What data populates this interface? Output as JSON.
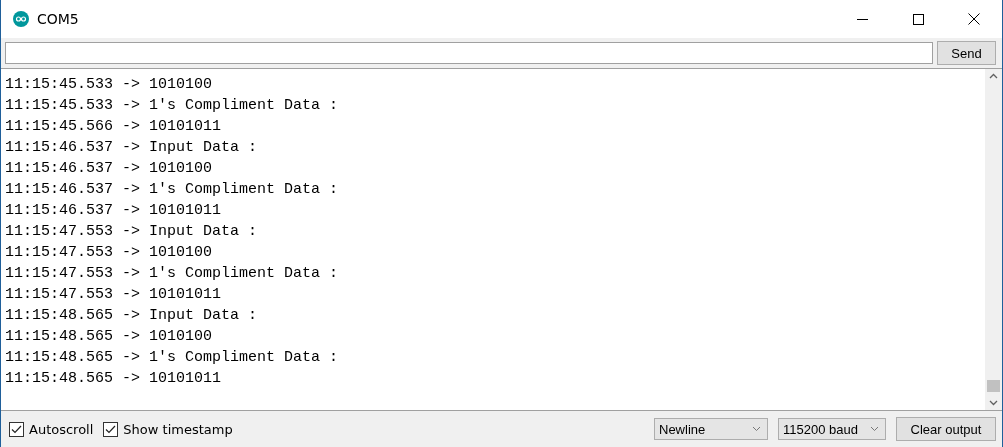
{
  "window": {
    "title": "COM5"
  },
  "send_button": "Send",
  "output_lines": [
    "11:15:45.533 -> 1010100",
    "11:15:45.533 -> 1's Compliment Data :",
    "11:15:45.566 -> 10101011",
    "11:15:46.537 -> Input Data :",
    "11:15:46.537 -> 1010100",
    "11:15:46.537 -> 1's Compliment Data :",
    "11:15:46.537 -> 10101011",
    "11:15:47.553 -> Input Data :",
    "11:15:47.553 -> 1010100",
    "11:15:47.553 -> 1's Compliment Data :",
    "11:15:47.553 -> 10101011",
    "11:15:48.565 -> Input Data :",
    "11:15:48.565 -> 1010100",
    "11:15:48.565 -> 1's Compliment Data :",
    "11:15:48.565 -> 10101011"
  ],
  "options": [
    {
      "label": "Autoscroll",
      "checked": true
    },
    {
      "label": "Show timestamp",
      "checked": true
    }
  ],
  "line_ending": "Newline",
  "baud_rate": "115200 baud",
  "clear_button": "Clear output"
}
